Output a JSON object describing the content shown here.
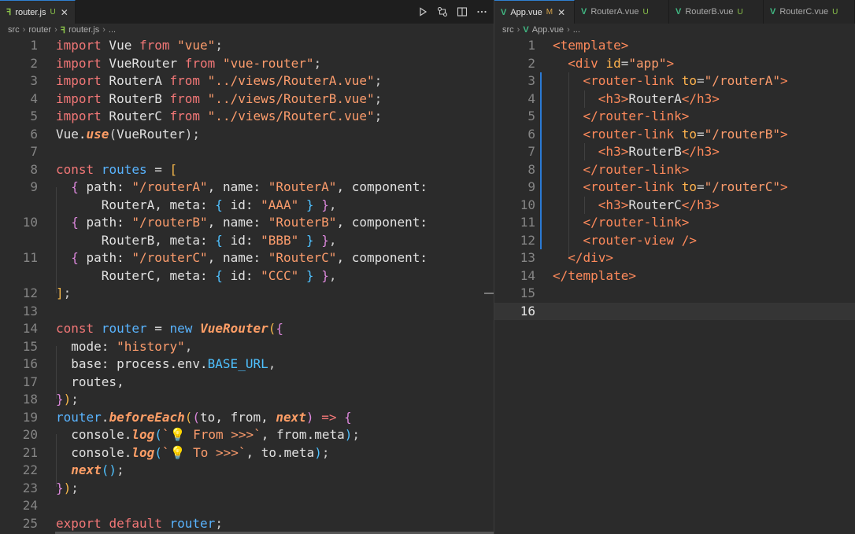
{
  "left": {
    "tabs": [
      {
        "label": "router.js",
        "status": "U",
        "icon": "js-file-icon",
        "active": true
      }
    ],
    "breadcrumb": [
      "src",
      "router",
      "router.js",
      "..."
    ],
    "actions": [
      "run-icon",
      "compare-icon",
      "split-editor-icon",
      "more-icon"
    ],
    "lines": [
      {
        "n": "1",
        "t": [
          [
            "k1",
            "import"
          ],
          [
            "id",
            " Vue "
          ],
          [
            "k1",
            "from"
          ],
          [
            "id",
            " "
          ],
          [
            "str",
            "\"vue\""
          ],
          [
            "op",
            ";"
          ]
        ]
      },
      {
        "n": "2",
        "t": [
          [
            "k1",
            "import"
          ],
          [
            "id",
            " VueRouter "
          ],
          [
            "k1",
            "from"
          ],
          [
            "id",
            " "
          ],
          [
            "str",
            "\"vue-router\""
          ],
          [
            "op",
            ";"
          ]
        ]
      },
      {
        "n": "3",
        "t": [
          [
            "k1",
            "import"
          ],
          [
            "id",
            " RouterA "
          ],
          [
            "k1",
            "from"
          ],
          [
            "id",
            " "
          ],
          [
            "str",
            "\"../views/RouterA.vue\""
          ],
          [
            "op",
            ";"
          ]
        ]
      },
      {
        "n": "4",
        "t": [
          [
            "k1",
            "import"
          ],
          [
            "id",
            " RouterB "
          ],
          [
            "k1",
            "from"
          ],
          [
            "id",
            " "
          ],
          [
            "str",
            "\"../views/RouterB.vue\""
          ],
          [
            "op",
            ";"
          ]
        ]
      },
      {
        "n": "5",
        "t": [
          [
            "k1",
            "import"
          ],
          [
            "id",
            " RouterC "
          ],
          [
            "k1",
            "from"
          ],
          [
            "id",
            " "
          ],
          [
            "str",
            "\"../views/RouterC.vue\""
          ],
          [
            "op",
            ";"
          ]
        ]
      },
      {
        "n": "6",
        "t": [
          [
            "id",
            "Vue."
          ],
          [
            "fn",
            "use"
          ],
          [
            "op",
            "("
          ],
          [
            "id",
            "VueRouter"
          ],
          [
            "op",
            ");"
          ]
        ]
      },
      {
        "n": "7",
        "t": []
      },
      {
        "n": "8",
        "t": [
          [
            "k1",
            "const"
          ],
          [
            "id",
            " "
          ],
          [
            "k2",
            "routes"
          ],
          [
            "id",
            " = "
          ],
          [
            "pr",
            "["
          ]
        ]
      },
      {
        "n": "9",
        "t": [
          [
            "id",
            "  "
          ],
          [
            "pp",
            "{"
          ],
          [
            "id",
            " path: "
          ],
          [
            "str",
            "\"/routerA\""
          ],
          [
            "id",
            ", name: "
          ],
          [
            "str",
            "\"RouterA\""
          ],
          [
            "id",
            ", component:"
          ]
        ]
      },
      {
        "n": "",
        "t": [
          [
            "id",
            "      RouterA, meta: "
          ],
          [
            "bl",
            "{"
          ],
          [
            "id",
            " id: "
          ],
          [
            "str",
            "\"AAA\""
          ],
          [
            "id",
            " "
          ],
          [
            "bl",
            "}"
          ],
          [
            "id",
            " "
          ],
          [
            "pp",
            "}"
          ],
          [
            "op",
            ","
          ]
        ]
      },
      {
        "n": "10",
        "t": [
          [
            "id",
            "  "
          ],
          [
            "pp",
            "{"
          ],
          [
            "id",
            " path: "
          ],
          [
            "str",
            "\"/routerB\""
          ],
          [
            "id",
            ", name: "
          ],
          [
            "str",
            "\"RouterB\""
          ],
          [
            "id",
            ", component:"
          ]
        ]
      },
      {
        "n": "",
        "t": [
          [
            "id",
            "      RouterB, meta: "
          ],
          [
            "bl",
            "{"
          ],
          [
            "id",
            " id: "
          ],
          [
            "str",
            "\"BBB\""
          ],
          [
            "id",
            " "
          ],
          [
            "bl",
            "}"
          ],
          [
            "id",
            " "
          ],
          [
            "pp",
            "}"
          ],
          [
            "op",
            ","
          ]
        ]
      },
      {
        "n": "11",
        "t": [
          [
            "id",
            "  "
          ],
          [
            "pp",
            "{"
          ],
          [
            "id",
            " path: "
          ],
          [
            "str",
            "\"/routerC\""
          ],
          [
            "id",
            ", name: "
          ],
          [
            "str",
            "\"RouterC\""
          ],
          [
            "id",
            ", component:"
          ]
        ]
      },
      {
        "n": "",
        "t": [
          [
            "id",
            "      RouterC, meta: "
          ],
          [
            "bl",
            "{"
          ],
          [
            "id",
            " id: "
          ],
          [
            "str",
            "\"CCC\""
          ],
          [
            "id",
            " "
          ],
          [
            "bl",
            "}"
          ],
          [
            "id",
            " "
          ],
          [
            "pp",
            "}"
          ],
          [
            "op",
            ","
          ]
        ]
      },
      {
        "n": "12",
        "t": [
          [
            "pr",
            "]"
          ],
          [
            "op",
            ";"
          ]
        ]
      },
      {
        "n": "13",
        "t": []
      },
      {
        "n": "14",
        "t": [
          [
            "k1",
            "const"
          ],
          [
            "id",
            " "
          ],
          [
            "k2",
            "router"
          ],
          [
            "id",
            " = "
          ],
          [
            "k2",
            "new"
          ],
          [
            "id",
            " "
          ],
          [
            "fn",
            "VueRouter"
          ],
          [
            "pr",
            "("
          ],
          [
            "pp",
            "{"
          ]
        ]
      },
      {
        "n": "15",
        "t": [
          [
            "id",
            "  mode: "
          ],
          [
            "str",
            "\"history\""
          ],
          [
            "op",
            ","
          ]
        ]
      },
      {
        "n": "16",
        "t": [
          [
            "id",
            "  base: process.env."
          ],
          [
            "bl",
            "BASE_URL"
          ],
          [
            "op",
            ","
          ]
        ]
      },
      {
        "n": "17",
        "t": [
          [
            "id",
            "  routes,"
          ]
        ]
      },
      {
        "n": "18",
        "t": [
          [
            "pp",
            "}"
          ],
          [
            "pr",
            ")"
          ],
          [
            "op",
            ";"
          ]
        ]
      },
      {
        "n": "19",
        "t": [
          [
            "k2",
            "router"
          ],
          [
            "id",
            "."
          ],
          [
            "fn",
            "beforeEach"
          ],
          [
            "pr",
            "("
          ],
          [
            "pp",
            "("
          ],
          [
            "id",
            "to, from, "
          ],
          [
            "fn",
            "next"
          ],
          [
            "pp",
            ")"
          ],
          [
            "id",
            " "
          ],
          [
            "k1",
            "=>"
          ],
          [
            "id",
            " "
          ],
          [
            "pp",
            "{"
          ]
        ]
      },
      {
        "n": "20",
        "t": [
          [
            "id",
            "  console."
          ],
          [
            "fn",
            "log"
          ],
          [
            "bl",
            "("
          ],
          [
            "str",
            "`💡 From >>>`"
          ],
          [
            "id",
            ", from.meta"
          ],
          [
            "bl",
            ")"
          ],
          [
            "op",
            ";"
          ]
        ]
      },
      {
        "n": "21",
        "t": [
          [
            "id",
            "  console."
          ],
          [
            "fn",
            "log"
          ],
          [
            "bl",
            "("
          ],
          [
            "str",
            "`💡 To >>>`"
          ],
          [
            "id",
            ", to.meta"
          ],
          [
            "bl",
            ")"
          ],
          [
            "op",
            ";"
          ]
        ]
      },
      {
        "n": "22",
        "t": [
          [
            "id",
            "  "
          ],
          [
            "fn",
            "next"
          ],
          [
            "bl",
            "()"
          ],
          [
            "op",
            ";"
          ]
        ]
      },
      {
        "n": "23",
        "t": [
          [
            "pp",
            "}"
          ],
          [
            "pr",
            ")"
          ],
          [
            "op",
            ";"
          ]
        ]
      },
      {
        "n": "24",
        "t": []
      },
      {
        "n": "25",
        "t": [
          [
            "k1",
            "export"
          ],
          [
            "id",
            " "
          ],
          [
            "k1",
            "default"
          ],
          [
            "id",
            " "
          ],
          [
            "k2",
            "router"
          ],
          [
            "op",
            ";"
          ]
        ]
      }
    ]
  },
  "right": {
    "tabs": [
      {
        "label": "App.vue",
        "status": "M",
        "icon": "vue-file-icon",
        "active": true
      },
      {
        "label": "RouterA.vue",
        "status": "U",
        "icon": "vue-file-icon",
        "active": false
      },
      {
        "label": "RouterB.vue",
        "status": "U",
        "icon": "vue-file-icon",
        "active": false
      },
      {
        "label": "RouterC.vue",
        "status": "U",
        "icon": "vue-file-icon",
        "active": false
      }
    ],
    "breadcrumb": [
      "src",
      "App.vue",
      "..."
    ],
    "current_line": "16",
    "lines": [
      {
        "n": "1",
        "t": [
          [
            "tg",
            "<template>"
          ]
        ]
      },
      {
        "n": "2",
        "t": [
          [
            "id",
            "  "
          ],
          [
            "tg",
            "<div "
          ],
          [
            "at",
            "id"
          ],
          [
            "op",
            "="
          ],
          [
            "str",
            "\"app\""
          ],
          [
            "tg",
            ">"
          ]
        ]
      },
      {
        "n": "3",
        "t": [
          [
            "id",
            "    "
          ],
          [
            "tg",
            "<router-link "
          ],
          [
            "at",
            "to"
          ],
          [
            "op",
            "="
          ],
          [
            "str",
            "\"/routerA\""
          ],
          [
            "tg",
            ">"
          ]
        ]
      },
      {
        "n": "4",
        "t": [
          [
            "id",
            "      "
          ],
          [
            "tg",
            "<h3>"
          ],
          [
            "id",
            "RouterA"
          ],
          [
            "tg",
            "</h3>"
          ]
        ]
      },
      {
        "n": "5",
        "t": [
          [
            "id",
            "    "
          ],
          [
            "tg",
            "</router-link>"
          ]
        ]
      },
      {
        "n": "6",
        "t": [
          [
            "id",
            "    "
          ],
          [
            "tg",
            "<router-link "
          ],
          [
            "at",
            "to"
          ],
          [
            "op",
            "="
          ],
          [
            "str",
            "\"/routerB\""
          ],
          [
            "tg",
            ">"
          ]
        ]
      },
      {
        "n": "7",
        "t": [
          [
            "id",
            "      "
          ],
          [
            "tg",
            "<h3>"
          ],
          [
            "id",
            "RouterB"
          ],
          [
            "tg",
            "</h3>"
          ]
        ]
      },
      {
        "n": "8",
        "t": [
          [
            "id",
            "    "
          ],
          [
            "tg",
            "</router-link>"
          ]
        ]
      },
      {
        "n": "9",
        "t": [
          [
            "id",
            "    "
          ],
          [
            "tg",
            "<router-link "
          ],
          [
            "at",
            "to"
          ],
          [
            "op",
            "="
          ],
          [
            "str",
            "\"/routerC\""
          ],
          [
            "tg",
            ">"
          ]
        ]
      },
      {
        "n": "10",
        "t": [
          [
            "id",
            "      "
          ],
          [
            "tg",
            "<h3>"
          ],
          [
            "id",
            "RouterC"
          ],
          [
            "tg",
            "</h3>"
          ]
        ]
      },
      {
        "n": "11",
        "t": [
          [
            "id",
            "    "
          ],
          [
            "tg",
            "</router-link>"
          ]
        ]
      },
      {
        "n": "12",
        "t": [
          [
            "id",
            "    "
          ],
          [
            "tg",
            "<router-view />"
          ]
        ]
      },
      {
        "n": "13",
        "t": [
          [
            "id",
            "  "
          ],
          [
            "tg",
            "</div>"
          ]
        ]
      },
      {
        "n": "14",
        "t": [
          [
            "tg",
            "</template>"
          ]
        ]
      },
      {
        "n": "15",
        "t": []
      },
      {
        "n": "16",
        "t": []
      }
    ]
  },
  "colors": {
    "js_icon": "#8bc34a",
    "vue_icon": "#41b883",
    "tab_active_border": "#2f80d0",
    "modified_bar": "#2b7bd6"
  }
}
